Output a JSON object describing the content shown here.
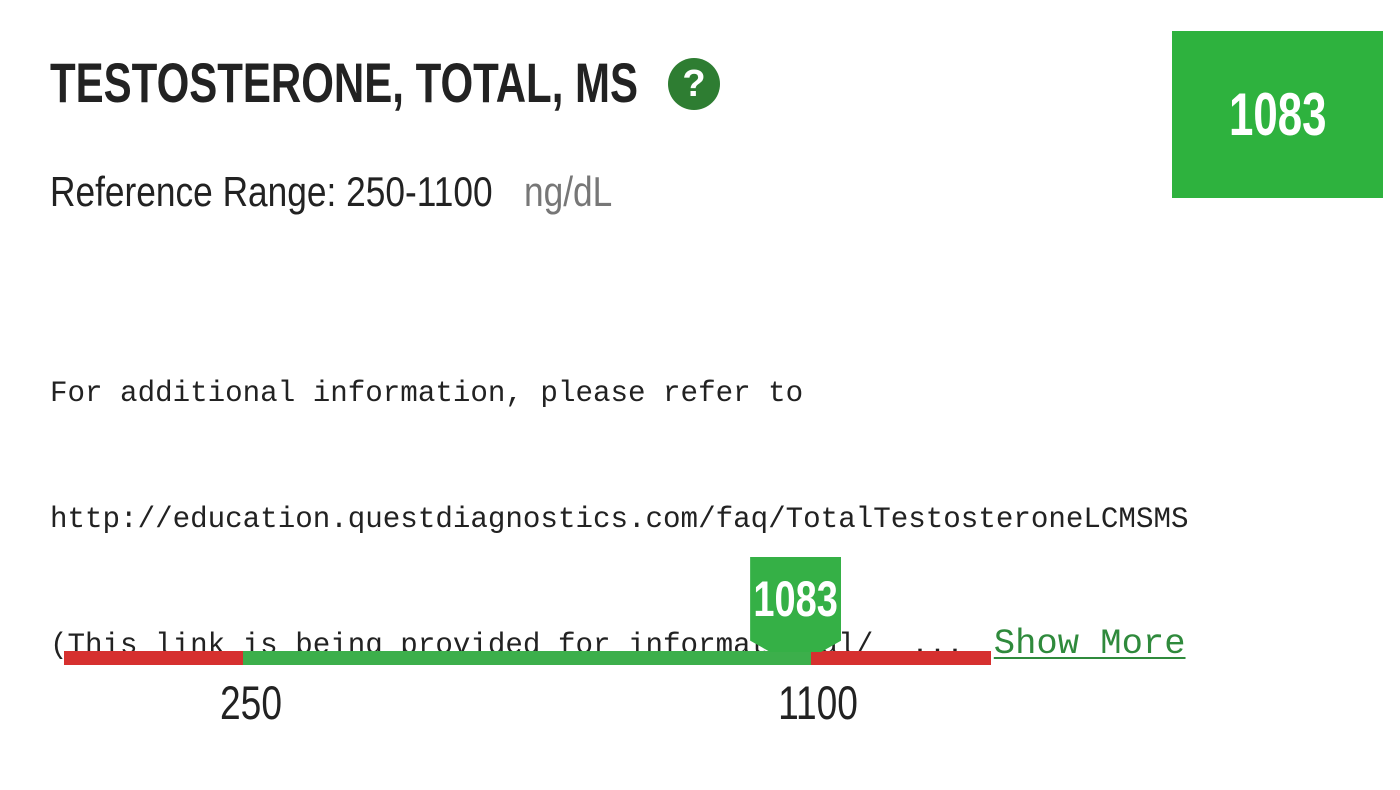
{
  "test": {
    "title": "TESTOSTERONE, TOTAL, MS",
    "reference_range": "Reference Range: 250-1100",
    "units": "ng/dL"
  },
  "icons": {
    "help": {
      "name": "help-icon",
      "glyph": "?"
    }
  },
  "result": {
    "value": 1083
  },
  "note": {
    "lines": [
      "For additional information, please refer to",
      "http://education.questdiagnostics.com/faq/TotalTestosteroneLCMSMS",
      "(This link is being provided for informational/"
    ],
    "ellipsis": "...",
    "show_more": "Show More"
  },
  "range_bar": {
    "low": 250,
    "high": 1100
  },
  "colors": {
    "result_fill": "#2eb23e",
    "marker_fill": "#35b046",
    "in_range": "#3caf4b",
    "out_of_range": "#d6302f",
    "help_icon": "#2e7d32",
    "link": "#2f8a3c"
  }
}
